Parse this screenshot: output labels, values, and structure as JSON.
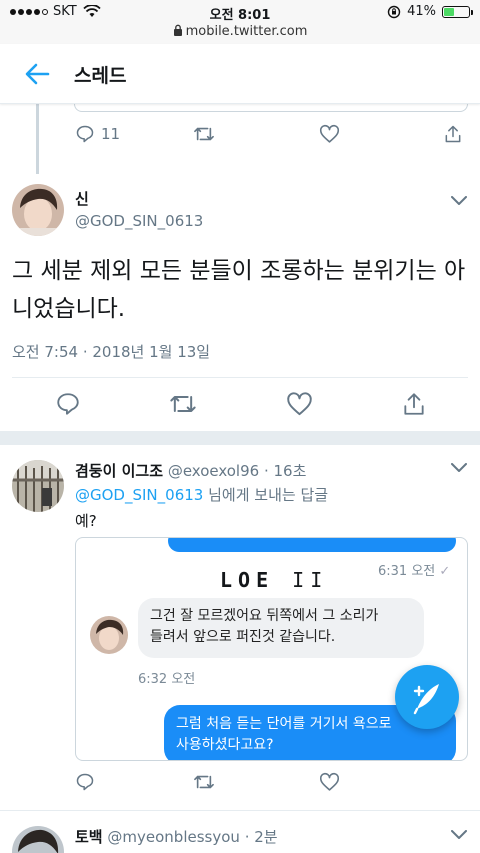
{
  "status_bar": {
    "carrier": "SKT",
    "time": "오전 8:01",
    "battery": "41%",
    "battery_fraction": 0.41,
    "url": "mobile.twitter.com"
  },
  "header": {
    "title": "스레드"
  },
  "prev_tweet": {
    "reply_count": "11"
  },
  "main_tweet": {
    "name": "신",
    "handle": "@GOD_SIN_0613",
    "text_line1": "그 세분 제외 모든 분들이 조롱하는 분위기는 아",
    "text_line2": "니었습니다.",
    "timestamp": "오전 7:54 · 2018년 1월 13일"
  },
  "reply_tweet": {
    "name": "겸둥이 이그조",
    "handle": "@exoexol96",
    "time": "· 16초",
    "mention": "@GOD_SIN_0613",
    "reply_suffix": "님에게 보내는 답글",
    "text": "예?",
    "media": {
      "header_text": "LOE",
      "header_suffix": "II",
      "time1": "6:31 오전",
      "grey_bubble_line1": "그건 잘 모르겠어요 뒤쪽에서 그 소리가",
      "grey_bubble_line2": "들려서 앞으로 퍼진것 같습니다.",
      "time2": "6:32 오전",
      "blue_bubble_line1": "그럼 처음 듣는 단어를 거기서 욕으로",
      "blue_bubble_line2": "사용하셨다고요?"
    }
  },
  "next_tweet": {
    "name": "토백",
    "handle": "@myeonblessyou",
    "time": "· 2분"
  },
  "colors": {
    "twitter_blue": "#1da1f2",
    "grey_text": "#657786",
    "divider": "#e6ecf0"
  },
  "icons": [
    "back-arrow-icon",
    "reply-icon",
    "retweet-icon",
    "like-icon",
    "share-icon",
    "chevron-down-icon",
    "compose-icon"
  ]
}
